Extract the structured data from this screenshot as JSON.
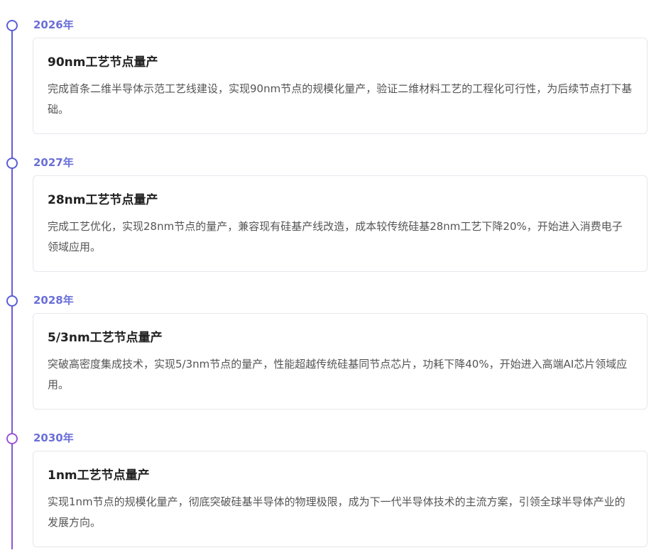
{
  "milestones": [
    {
      "year": "2026年",
      "title": "90nm工艺节点量产",
      "description": "完成首条二维半导体示范工艺线建设，实现90nm节点的规模化量产，验证二维材料工艺的工程化可行性，为后续节点打下基础。"
    },
    {
      "year": "2027年",
      "title": "28nm工艺节点量产",
      "description": "完成工艺优化，实现28nm节点的量产，兼容现有硅基产线改造，成本较传统硅基28nm工艺下降20%，开始进入消费电子领域应用。"
    },
    {
      "year": "2028年",
      "title": "5/3nm工艺节点量产",
      "description": "突破高密度集成技术，实现5/3nm节点的量产，性能超越传统硅基同节点芯片，功耗下降40%，开始进入高端AI芯片领域应用。"
    },
    {
      "year": "2030年",
      "title": "1nm工艺节点量产",
      "description": "实现1nm节点的规模化量产，彻底突破硅基半导体的物理极限，成为下一代半导体技术的主流方案，引领全球半导体产业的发展方向。"
    }
  ],
  "colors": {
    "accent": "#5b5fd6",
    "accent_end": "#9b55d4",
    "year_text": "#6a6fd8",
    "card_border": "#e7e7ee"
  }
}
